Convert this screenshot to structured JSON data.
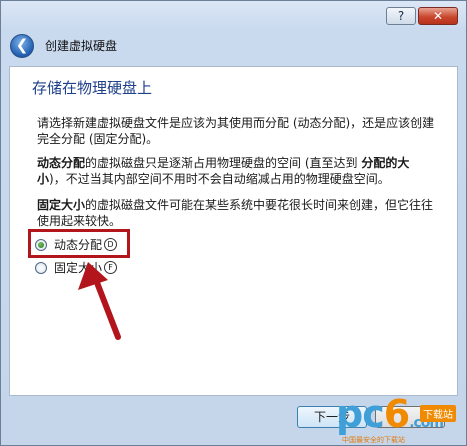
{
  "window": {
    "help_label": "?",
    "close_label": "✕"
  },
  "header": {
    "title": "创建虚拟硬盘"
  },
  "main": {
    "heading": "存储在物理硬盘上",
    "para1": "请选择新建虚拟硬盘文件是应该为其使用而分配 (动态分配)，还是应该创建完全分配 (固定分配)。",
    "para2_bold": "动态分配",
    "para2_mid": "的虚拟磁盘只是逐渐占用物理硬盘的空间 (直至达到 ",
    "para2_bold2": "分配的大小",
    "para2_end": ")，不过当其内部空间不用时不会自动缩减占用的物理硬盘空间。",
    "para3_bold": "固定大小",
    "para3_rest": "的虚拟磁盘文件可能在某些系统中要花很长时间来创建，但它往往使用起来较快。",
    "options": [
      {
        "label": "动态分配",
        "accel": "D",
        "selected": true
      },
      {
        "label": "固定大小",
        "accel": "F",
        "selected": false
      }
    ]
  },
  "footer": {
    "next_label": "下一步"
  },
  "watermark": {
    "brand_a": "pc",
    "brand_b": "6",
    "brand_c": ".com",
    "badge": "下载站",
    "tagline": "中国最安全的下载站"
  },
  "colors": {
    "heading": "#1e3f8a",
    "annotation": "#b3151c"
  }
}
